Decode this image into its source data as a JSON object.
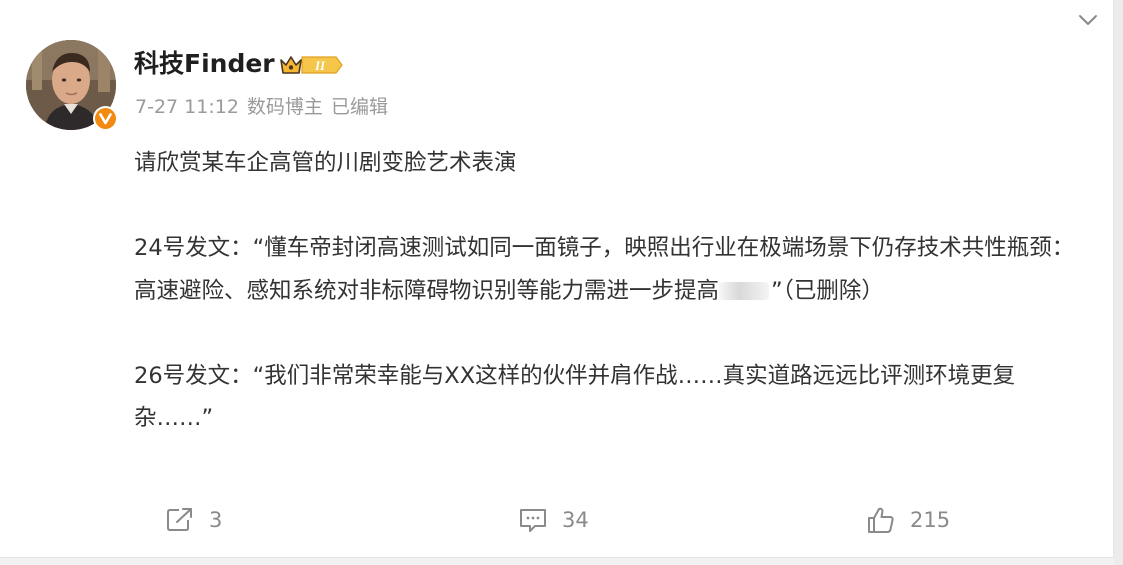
{
  "post": {
    "author": "科技Finder",
    "meta": {
      "date": "7-27 11:12",
      "role": "数码博主",
      "edited": "已编辑"
    },
    "paragraphs": {
      "intro": "请欣赏某车企高管的川剧变脸艺术表演",
      "p24_main": "24号发文：“懂车帝封闭高速测试如同一面镜子，映照出行业在极端场景下仍存技术共性瓶颈：高速避险、感知系统对非标障碍物识别等能力需进一步提高",
      "p24_tail": "”（已删除）",
      "p26": "26号发文：“我们非常荣幸能与XX这样的伙伴并肩作战……真实道路远远比评测环境更复杂……”"
    },
    "badge": {
      "level": "II"
    },
    "actions": {
      "share_count": "3",
      "comment_count": "34",
      "like_count": "215"
    }
  },
  "icons": {
    "more": "chevron-down-icon",
    "share": "share-icon",
    "comment": "comment-icon",
    "like": "thumbs-up-icon",
    "verified": "verified-v-icon"
  },
  "colors": {
    "verified_orange": "#f28a12",
    "badge_gold": "#f5b731",
    "text_main": "#333333",
    "text_meta": "#9a9a9a"
  }
}
